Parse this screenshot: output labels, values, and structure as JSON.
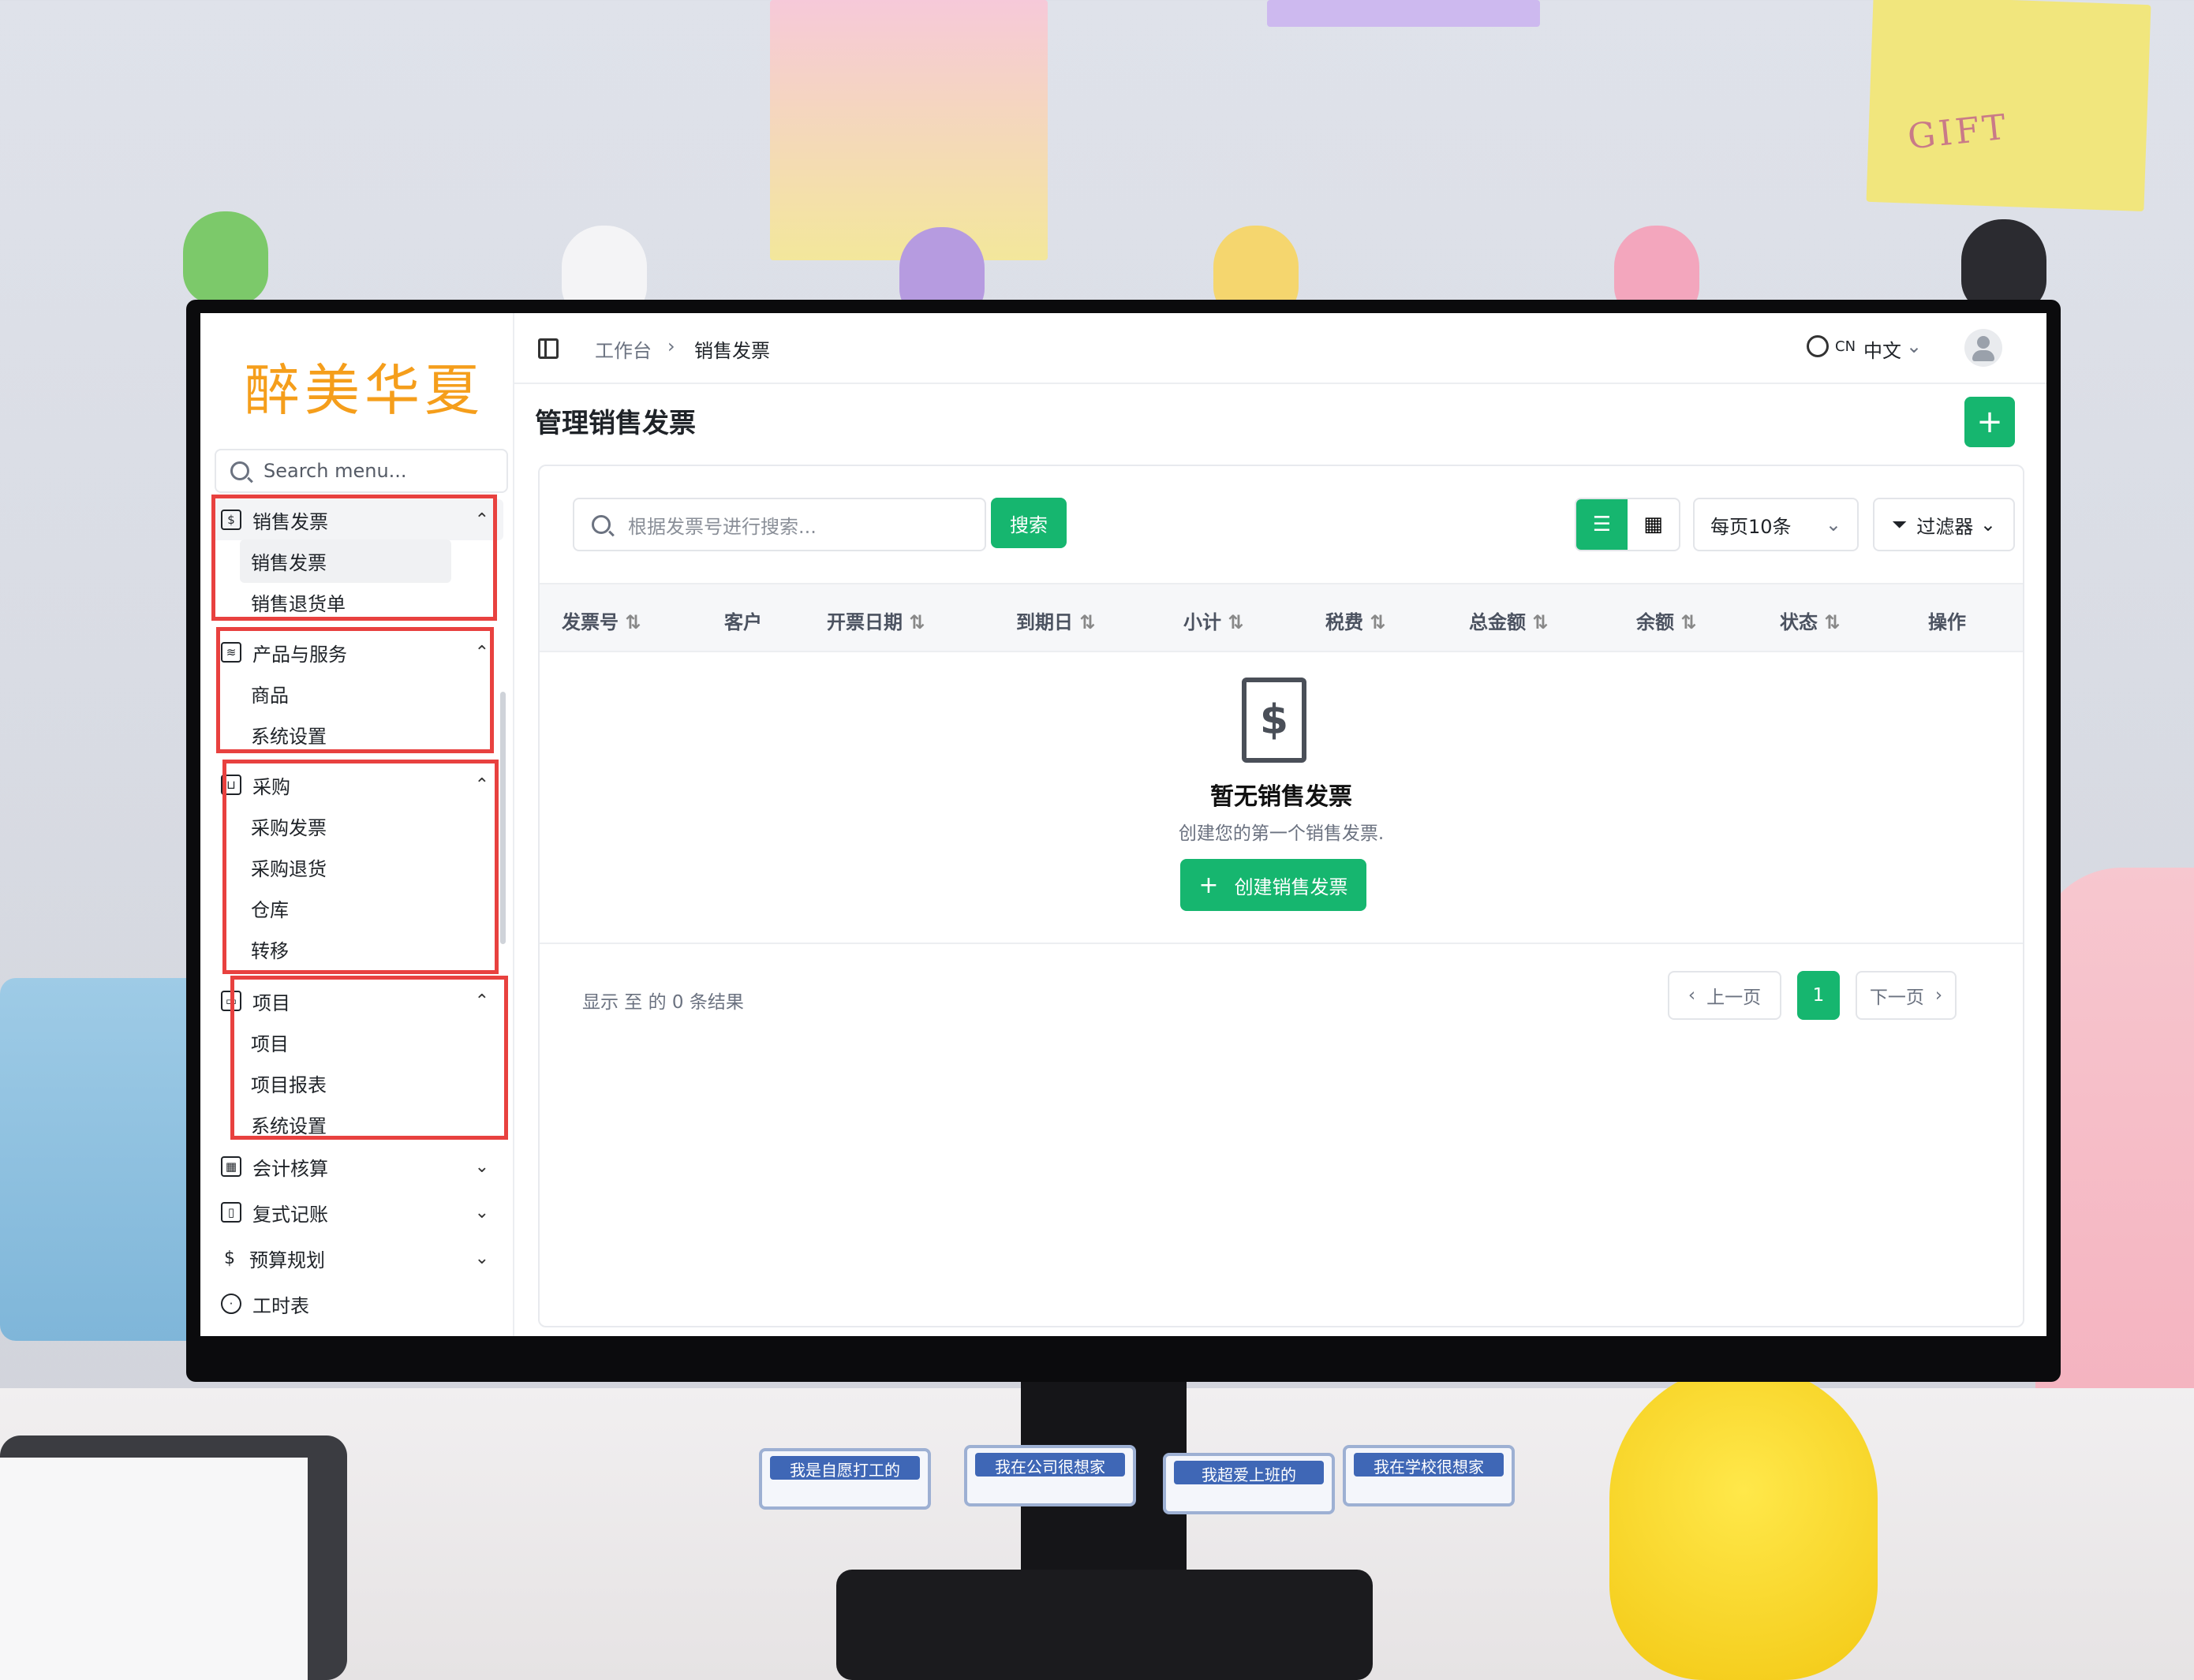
{
  "app": {
    "logo": "醉美华夏",
    "menu_search_placeholder": "Search menu..."
  },
  "sidebar": {
    "groups": [
      {
        "label": "销售发票",
        "icon": "invoice-dollar-icon",
        "expanded": true,
        "items": [
          {
            "label": "销售发票",
            "active": true
          },
          {
            "label": "销售退货单"
          }
        ]
      },
      {
        "label": "产品与服务",
        "icon": "layers-icon",
        "expanded": true,
        "items": [
          {
            "label": "商品"
          },
          {
            "label": "系统设置"
          }
        ]
      },
      {
        "label": "采购",
        "icon": "cart-icon",
        "expanded": true,
        "items": [
          {
            "label": "采购发票"
          },
          {
            "label": "采购退货"
          },
          {
            "label": "仓库"
          },
          {
            "label": "转移"
          }
        ]
      },
      {
        "label": "项目",
        "icon": "folder-icon",
        "expanded": true,
        "items": [
          {
            "label": "项目"
          },
          {
            "label": "项目报表"
          },
          {
            "label": "系统设置"
          }
        ]
      },
      {
        "label": "会计核算",
        "icon": "calculator-icon",
        "expanded": false,
        "items": []
      },
      {
        "label": "复式记账",
        "icon": "book-open-icon",
        "expanded": false,
        "items": []
      },
      {
        "label": "预算规划",
        "icon": "dollar-icon",
        "expanded": false,
        "items": []
      },
      {
        "label": "工时表",
        "icon": "clock-icon",
        "expanded": false,
        "items": []
      }
    ],
    "highlight_color": "#e8413f"
  },
  "header": {
    "breadcrumb": [
      "工作台",
      "销售发票"
    ],
    "locale_code": "CN",
    "locale_label": "中文"
  },
  "page": {
    "title": "管理销售发票",
    "add_button": "+"
  },
  "toolbar": {
    "search_placeholder": "根据发票号进行搜索...",
    "search_button": "搜索",
    "per_page": "每页10条",
    "filter": "过滤器"
  },
  "table": {
    "columns": [
      "发票号",
      "客户",
      "开票日期",
      "到期日",
      "小计",
      "税费",
      "总金额",
      "余额",
      "状态",
      "操作"
    ],
    "rows": []
  },
  "empty_state": {
    "title": "暂无销售发票",
    "subtitle": "创建您的第一个销售发票.",
    "button": "创建销售发票"
  },
  "pagination": {
    "summary": "显示 至 的 0 条结果",
    "prev": "上一页",
    "current": "1",
    "next": "下一页"
  },
  "colors": {
    "accent": "#16b66f",
    "logo": "#f59e1b"
  },
  "room": {
    "poster_text": "GIFT",
    "desk_signs": [
      "我是自愿打工的",
      "我在公司很想家",
      "我超爱上班的",
      "我在学校很想家"
    ]
  }
}
